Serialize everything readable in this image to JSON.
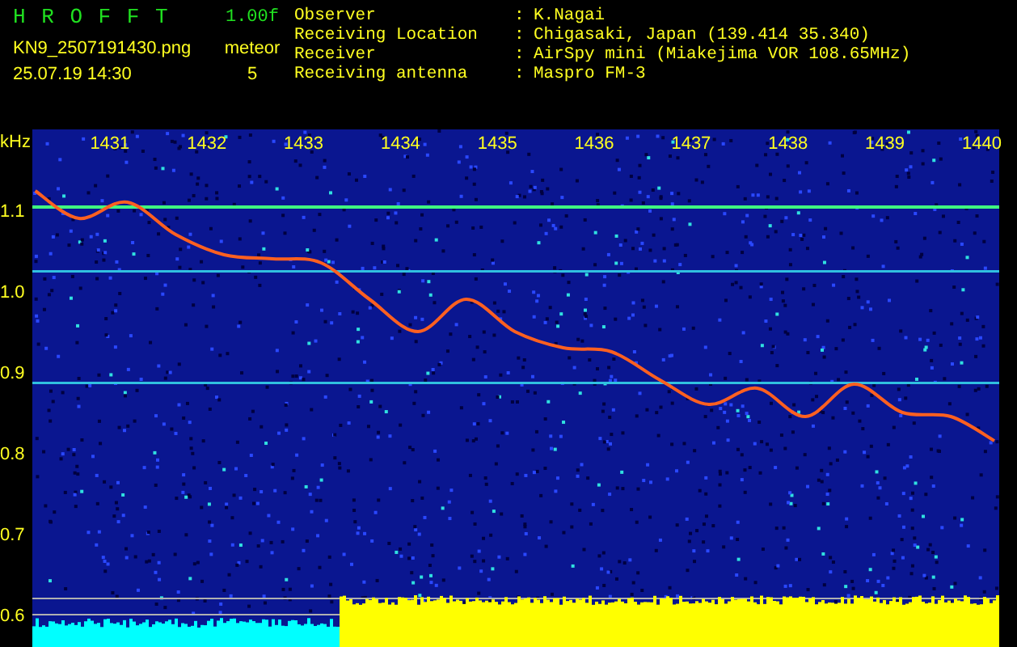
{
  "header": {
    "program_title": "H R O F F T",
    "version": "1.00f",
    "file_name": "KN9_2507191430.png",
    "mode": "meteor",
    "date_time": "25.07.19 14:30",
    "count": "5"
  },
  "info": [
    {
      "label": "Observer",
      "separator": ":",
      "value": "K.Nagai"
    },
    {
      "label": "Receiving Location",
      "separator": ":",
      "value": "Chigasaki, Japan (139.414 35.340)"
    },
    {
      "label": "Receiver",
      "separator": ":",
      "value": "AirSpy mini (Miakejima VOR 108.65MHz)"
    },
    {
      "label": "Receiving antenna",
      "separator": ":",
      "value": "Maspro FM-3"
    }
  ],
  "plot": {
    "chart_data": {
      "type": "line",
      "ylabel": "kHz",
      "xlim": [
        1430.2,
        1440.18
      ],
      "ylim": [
        0.56,
        1.2
      ],
      "xticks": [
        1431,
        1432,
        1433,
        1434,
        1435,
        1436,
        1437,
        1438,
        1439,
        1440
      ],
      "yticks": [
        {
          "value": 1.1,
          "label": "1.1"
        },
        {
          "value": 1.0,
          "label": "1.0"
        },
        {
          "value": 0.9,
          "label": "0.9"
        },
        {
          "value": 0.8,
          "label": "0.8"
        },
        {
          "value": 0.7,
          "label": "0.7"
        },
        {
          "value": 0.6,
          "label": "0.6"
        }
      ],
      "x": [
        1430.23,
        1430.68,
        1431.18,
        1431.68,
        1432.18,
        1432.68,
        1433.18,
        1433.68,
        1434.18,
        1434.68,
        1435.18,
        1435.68,
        1436.18,
        1436.68,
        1437.18,
        1437.68,
        1438.18,
        1438.68,
        1439.18,
        1439.68,
        1440.13
      ],
      "series": [
        {
          "color": "#ff6020",
          "values": [
            1.124,
            1.09,
            1.11,
            1.07,
            1.045,
            1.04,
            1.035,
            0.99,
            0.95,
            0.99,
            0.95,
            0.93,
            0.925,
            0.89,
            0.86,
            0.88,
            0.845,
            0.885,
            0.85,
            0.845,
            0.815
          ]
        }
      ]
    }
  }
}
